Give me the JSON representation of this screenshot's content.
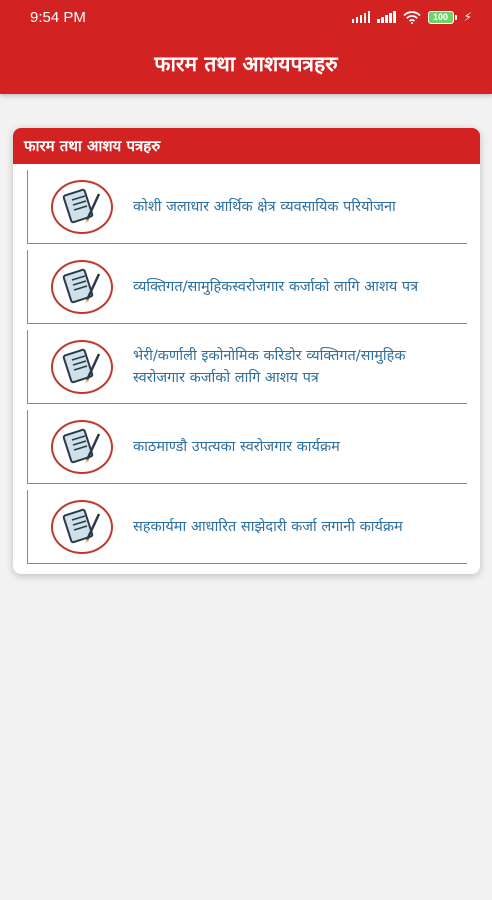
{
  "status_bar": {
    "time": "9:54 PM",
    "battery": "100"
  },
  "app_bar": {
    "title": "फारम तथा आशयपत्रहरु"
  },
  "card": {
    "header": "फारम तथा आशय पत्रहरु",
    "items": [
      {
        "label": "कोशी जलाधार आर्थिक क्षेत्र व्यवसायिक परियोजना",
        "icon": "document-form-icon"
      },
      {
        "label": "व्यक्तिगत/सामुहिकस्वरोजगार कर्जाको लागि आशय पत्र",
        "icon": "document-form-icon"
      },
      {
        "label": "भेरी/कर्णाली इकोनोमिक करिडोर व्यक्तिगत/सामुहिक स्वरोजगार कर्जाको लागि आशय पत्र",
        "icon": "document-form-icon"
      },
      {
        "label": "काठमाण्डौ उपत्यका स्वरोजगार कार्यक्रम",
        "icon": "document-form-icon"
      },
      {
        "label": "सहकार्यमा आधारित साझेदारी कर्जा लगानी कार्यक्रम",
        "icon": "document-form-icon"
      }
    ]
  },
  "colors": {
    "primary": "#d32222",
    "link_text": "#2f6f9f",
    "divider": "#6f8fa6",
    "background": "#f2f2f2"
  }
}
